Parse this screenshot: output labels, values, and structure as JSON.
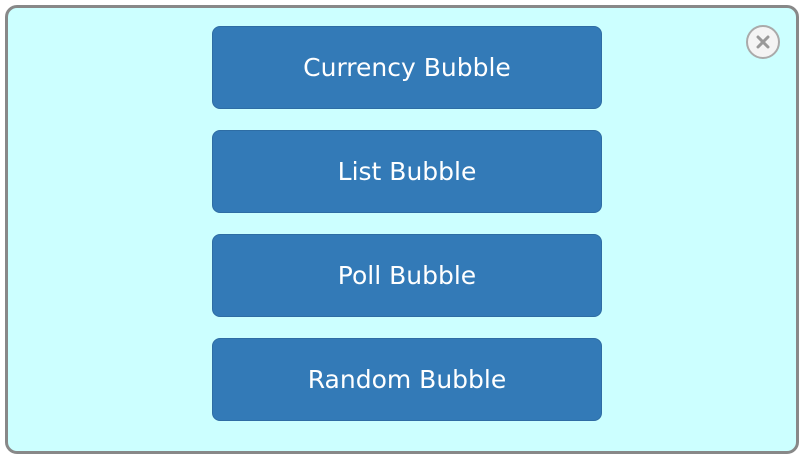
{
  "modal": {
    "buttons": [
      {
        "label": "Currency Bubble"
      },
      {
        "label": "List Bubble"
      },
      {
        "label": "Poll Bubble"
      },
      {
        "label": "Random Bubble"
      }
    ],
    "close": {
      "icon": "close-icon"
    }
  },
  "colors": {
    "modal_background": "#ccffff",
    "modal_border": "#888888",
    "button_background": "#337ab7",
    "button_border": "#2e6da4",
    "button_text": "#ffffff"
  }
}
